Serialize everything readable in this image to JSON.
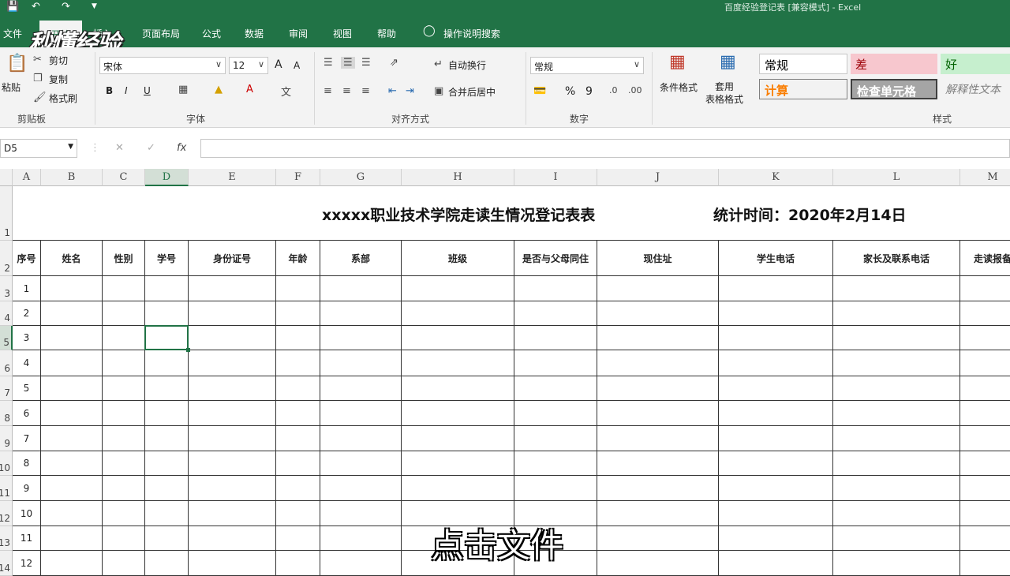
{
  "window": {
    "title": "百度经验登记表 [兼容模式] - Excel"
  },
  "watermark": "秒懂经验",
  "tabs": [
    {
      "label": "文件",
      "active": false
    },
    {
      "label": "开始",
      "active": true
    },
    {
      "label": "插入",
      "active": false
    },
    {
      "label": "页面布局",
      "active": false
    },
    {
      "label": "公式",
      "active": false
    },
    {
      "label": "数据",
      "active": false
    },
    {
      "label": "审阅",
      "active": false
    },
    {
      "label": "视图",
      "active": false
    },
    {
      "label": "帮助",
      "active": false
    },
    {
      "label": "操作说明搜索",
      "active": false
    }
  ],
  "ribbon": {
    "clipboard": {
      "paste": "粘贴",
      "cut": "剪切",
      "copy": "复制",
      "format_painter": "格式刷",
      "label": "剪贴板"
    },
    "font": {
      "name": "宋体",
      "size": "12",
      "bold": "B",
      "italic": "I",
      "underline": "U",
      "grow": "A",
      "shrink": "A",
      "label": "字体"
    },
    "alignment": {
      "wrap": "自动换行",
      "merge": "合并后居中",
      "label": "对齐方式"
    },
    "number": {
      "format": "常规",
      "percent": "%",
      "comma": "9",
      "label": "数字"
    },
    "styles": {
      "conditional": "条件格式",
      "table": "套用\n表格格式",
      "normal": "常规",
      "bad": "差",
      "good": "好",
      "calc": "计算",
      "check": "检查单元格",
      "explain": "解释性文本",
      "label": "样式"
    }
  },
  "formula_bar": {
    "name_box": "D5",
    "fx": "fx",
    "value": ""
  },
  "sheet": {
    "columns": [
      "A",
      "B",
      "C",
      "D",
      "E",
      "F",
      "G",
      "H",
      "I",
      "J",
      "K",
      "L",
      "M"
    ],
    "selected_column": "D",
    "selected_row": 5,
    "row_numbers": [
      "1",
      "2",
      "3",
      "4",
      "5",
      "6",
      "7",
      "8",
      "9",
      "10",
      "11",
      "12",
      "13",
      "14"
    ],
    "title": "xxxxx职业技术学院走读生情况登记表表",
    "stat_time": "统计时间：2020年2月14日",
    "headers": [
      "序号",
      "姓名",
      "性别",
      "学号",
      "身份证号",
      "年龄",
      "系部",
      "班级",
      "是否与父母同住",
      "现住址",
      "学生电话",
      "家长及联系电话",
      "走读报备"
    ],
    "serials": [
      "1",
      "2",
      "3",
      "4",
      "5",
      "6",
      "7",
      "8",
      "9",
      "10",
      "11",
      "12"
    ]
  },
  "subtitle": "点击文件"
}
